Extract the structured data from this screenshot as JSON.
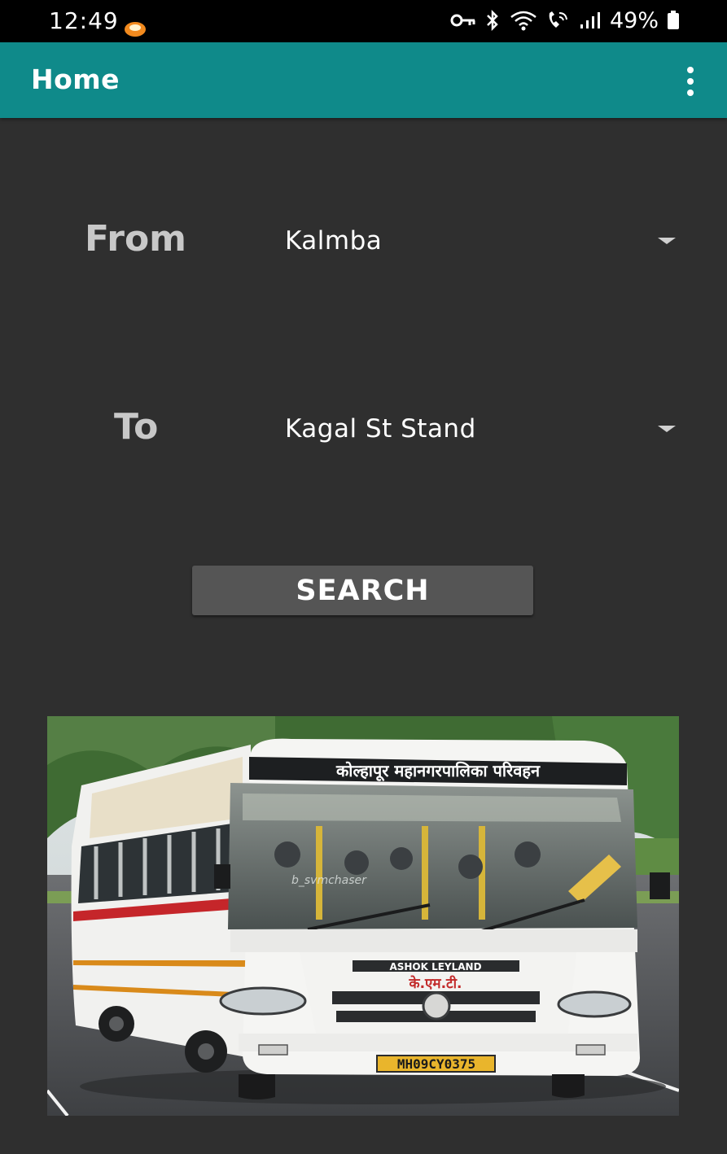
{
  "status_bar": {
    "time": "12:49",
    "battery": "49%"
  },
  "app_bar": {
    "title": "Home"
  },
  "form": {
    "from_label": "From",
    "from_value": "Kalmba",
    "to_label": "To",
    "to_value": "Kagal St Stand",
    "search_label": "SEARCH"
  },
  "bus_photo": {
    "destination_board": "कोल्हापूर महानगरपालिका परिवहन",
    "brand": "ASHOK LEYLAND",
    "operator": "के.एम.टी.",
    "plate": "MH09CY0375",
    "watermark": "b_svmchaser"
  }
}
